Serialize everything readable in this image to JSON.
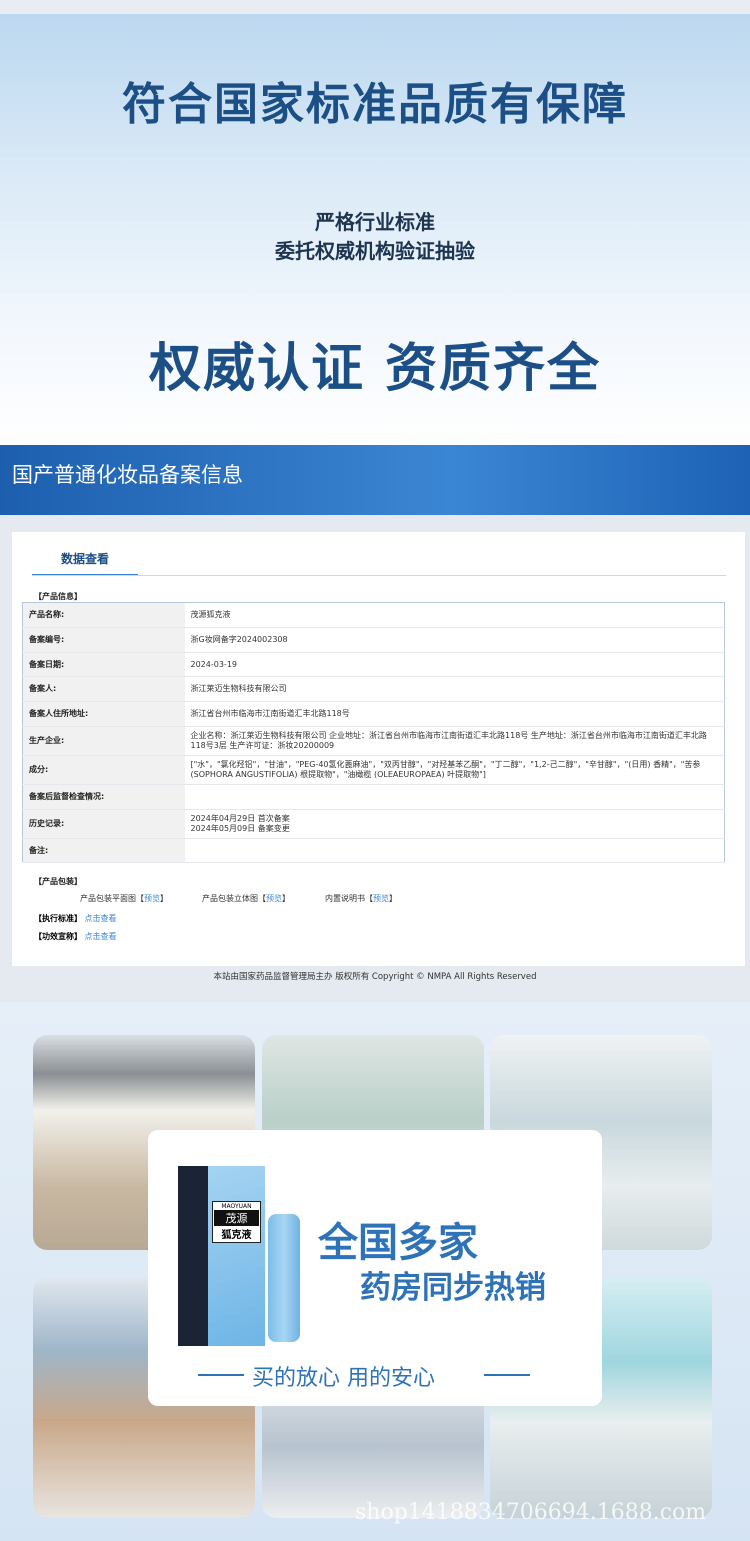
{
  "hero": {
    "title": "符合国家标准品质有保障",
    "sub1": "严格行业标准",
    "sub2": "委托权威机构验证抽验",
    "headline": "权威认证 资质齐全"
  },
  "band": {
    "title": "国产普通化妆品备案信息"
  },
  "record": {
    "tab": "数据查看",
    "section_info": "【产品信息】",
    "rows": [
      {
        "k": "产品名称:",
        "v": "茂源狐克液"
      },
      {
        "k": "备案编号:",
        "v": "浙G妆网备字2024002308"
      },
      {
        "k": "备案日期:",
        "v": "2024-03-19"
      },
      {
        "k": "备案人:",
        "v": "浙江莱迈生物科技有限公司"
      },
      {
        "k": "备案人住所地址:",
        "v": "浙江省台州市临海市江南街道汇丰北路118号"
      },
      {
        "k": "生产企业:",
        "v": "企业名称：浙江莱迈生物科技有限公司 企业地址：浙江省台州市临海市江南街道汇丰北路118号 生产地址：浙江省台州市临海市江南街道汇丰北路118号3层 生产许可证：浙妆20200009"
      },
      {
        "k": "成分:",
        "v": "[\"水\"，\"氯化羟铝\"，\"甘油\"，\"PEG-40氢化蓖麻油\"，\"双丙甘醇\"，\"对羟基苯乙酮\"，\"丁二醇\"，\"1,2-己二醇\"，\"辛甘醇\"，\"(日用) 香精\"，\"苦参 (SOPHORA ANGUSTIFOLIA) 根提取物\"，\"油橄榄 (OLEAEUROPAEA) 叶提取物\"]"
      },
      {
        "k": "备案后监督检查情况:",
        "v": ""
      },
      {
        "k": "历史记录:",
        "v": "2024年04月29日 首次备案",
        "v2": "2024年05月09日 备案变更"
      },
      {
        "k": "备注:",
        "v": ""
      }
    ],
    "section_pack": "【产品包装】",
    "pack": [
      {
        "label": "产品包装平面图",
        "link": "预览"
      },
      {
        "label": "产品包装立体图",
        "link": "预览"
      },
      {
        "label": "内置说明书",
        "link": "预览"
      }
    ],
    "standard_label": "【执行标准】",
    "standard_link": "点击查看",
    "claim_label": "【功效宣称】",
    "claim_link": "点击查看",
    "copyright": "本站由国家药品监督管理局主办 版权所有 Copyright © NMPA All Rights Reserved"
  },
  "promo": {
    "line1": "全国多家",
    "line2": "药房同步热销",
    "tagline": "买的放心  用的安心",
    "brand": "MAOYUAN",
    "product": "狐克液",
    "brand_cn": "茂源",
    "accent": "#2e72b8",
    "watermark": "shop1418834706694.1688.com"
  }
}
